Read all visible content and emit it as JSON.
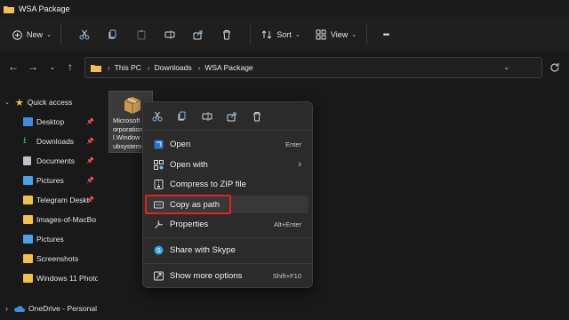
{
  "window": {
    "title": "WSA Package"
  },
  "toolbar": {
    "new_label": "New",
    "sort_label": "Sort",
    "view_label": "View",
    "more_label": "•••"
  },
  "address": {
    "crumbs": [
      "This PC",
      "Downloads",
      "WSA Package"
    ]
  },
  "sidebar": {
    "items": [
      {
        "label": "Quick access"
      },
      {
        "label": "Desktop"
      },
      {
        "label": "Downloads"
      },
      {
        "label": "Documents"
      },
      {
        "label": "Pictures"
      },
      {
        "label": "Telegram Deskt"
      },
      {
        "label": "Images-of-MacBo"
      },
      {
        "label": "Pictures"
      },
      {
        "label": "Screenshots"
      },
      {
        "label": "Windows 11 Photo"
      },
      {
        "label": "OneDrive - Personal"
      }
    ]
  },
  "file": {
    "name": "Microsoft\norporation\nl.Window\nubsystem"
  },
  "context_menu": {
    "items": [
      {
        "label": "Open",
        "shortcut": "Enter"
      },
      {
        "label": "Open with",
        "shortcut": ""
      },
      {
        "label": "Compress to ZIP file",
        "shortcut": ""
      },
      {
        "label": "Copy as path",
        "shortcut": ""
      },
      {
        "label": "Properties",
        "shortcut": "Alt+Enter"
      },
      {
        "label": "Share with Skype",
        "shortcut": ""
      },
      {
        "label": "Show more options",
        "shortcut": "Shift+F10"
      }
    ],
    "submenu_arrow": "›"
  },
  "colors": {
    "accent_highlight": "#e2231a",
    "folder": "#f3c04d"
  }
}
